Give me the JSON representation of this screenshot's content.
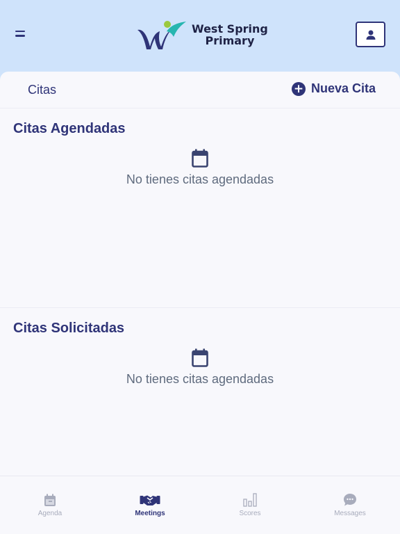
{
  "header": {
    "menu_icon": "menu-icon",
    "logo_line1": "West Spring",
    "logo_line2": "Primary",
    "profile_icon": "person-icon"
  },
  "page": {
    "title": "Citas",
    "new_button_label": "Nueva Cita",
    "new_button_icon": "plus-circle-icon"
  },
  "sections": [
    {
      "title": "Citas Agendadas",
      "empty_text": "No tienes citas agendadas",
      "icon": "calendar-icon"
    },
    {
      "title": "Citas Solicitadas",
      "empty_text": "No tienes citas agendadas",
      "icon": "calendar-icon"
    }
  ],
  "tabs": [
    {
      "label": "Agenda",
      "icon": "calendar-icon",
      "active": false
    },
    {
      "label": "Meetings",
      "icon": "handshake-icon",
      "active": true
    },
    {
      "label": "Scores",
      "icon": "bar-chart-icon",
      "active": false
    },
    {
      "label": "Messages",
      "icon": "chat-bubble-icon",
      "active": false
    }
  ],
  "colors": {
    "header_bg": "#cfe3fb",
    "primary": "#2f3478",
    "inactive": "#a8acbc",
    "logo_teal": "#27b6b0",
    "logo_green": "#9bc93e"
  }
}
